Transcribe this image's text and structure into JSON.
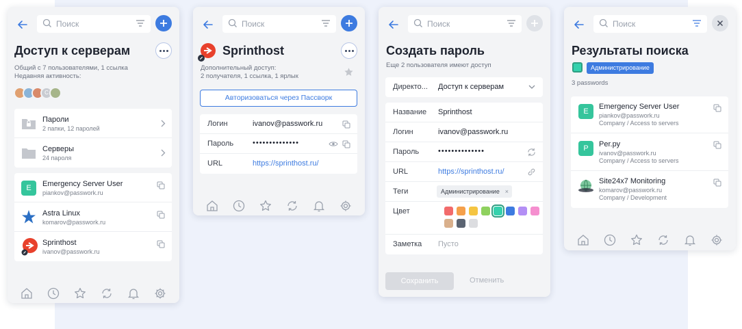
{
  "search_placeholder": "Поиск",
  "nav_icons": [
    "home-icon",
    "clock-icon",
    "star-icon",
    "sync-icon",
    "bell-icon",
    "gear-icon"
  ],
  "colors": {
    "accent": "#3d7be0",
    "green_badge": "#35c59c",
    "sprint_red": "#e8412c"
  },
  "panel1": {
    "title": "Доступ к серверам",
    "share_info": "Общий с 7 пользователями, 1 ссылка",
    "recent_label": "Недавняя активность:",
    "avatar_initial": "С",
    "folders": [
      {
        "name": "Пароли",
        "meta": "2 папки, 12 паролей"
      },
      {
        "name": "Серверы",
        "meta": "24 пароля"
      }
    ],
    "items": [
      {
        "name": "Emergency Server User",
        "login": "piankov@passwork.ru",
        "letter": "E"
      },
      {
        "name": "Astra Linux",
        "login": "komarov@passwork.ru"
      },
      {
        "name": "Sprinthost",
        "login": "ivanov@passwork.ru"
      }
    ]
  },
  "panel2": {
    "title": "Sprinthost",
    "extra_access_label": "Дополнительный доступ:",
    "extra_access_value": "2 получателя, 1 ссылка, 1 ярлык",
    "auth_button": "Авторизоваться через Пассворк",
    "fields": [
      {
        "label": "Логин",
        "value": "ivanov@passwork.ru"
      },
      {
        "label": "Пароль",
        "value": "••••••••••••••"
      },
      {
        "label": "URL",
        "value": "https://sprinthost.ru/"
      }
    ]
  },
  "panel3": {
    "title": "Создать пароль",
    "subtitle": "Еще 2 пользователя имеют доступ",
    "directory_label": "Директо...",
    "directory_value": "Доступ к серверам",
    "name_label": "Название",
    "name_value": "Sprinthost",
    "login_label": "Логин",
    "login_value": "ivanov@passwork.ru",
    "password_label": "Пароль",
    "password_value": "••••••••••••••",
    "url_label": "URL",
    "url_value": "https://sprinthost.ru/",
    "tags_label": "Теги",
    "tag_value": "Администрирование",
    "color_label": "Цвет",
    "swatches": [
      "#f26b6b",
      "#f5a04b",
      "#f5c542",
      "#8fd15f",
      "#35d1ad",
      "#3d7be0",
      "#b38ff5",
      "#f58fcf",
      "#d9b08c",
      "#5b6472",
      "#dcdde0"
    ],
    "selected_swatch": 4,
    "note_label": "Заметка",
    "note_placeholder": "Пусто",
    "save_button": "Сохранить",
    "cancel_button": "Отменить"
  },
  "panel4": {
    "title": "Результаты поиска",
    "filter_tag": "Администрирование",
    "count": "3 passwords",
    "results": [
      {
        "name": "Emergency Server User",
        "login": "piankov@passwork.ru",
        "path": "Company / Access to servers",
        "letter": "E"
      },
      {
        "name": "Per.py",
        "login": "ivanov@passwork.ru",
        "path": "Company / Access to servers",
        "letter": "P"
      },
      {
        "name": "Site24x7 Monitoring",
        "login": "komarov@passwork.ru",
        "path": "Company / Development"
      }
    ]
  }
}
